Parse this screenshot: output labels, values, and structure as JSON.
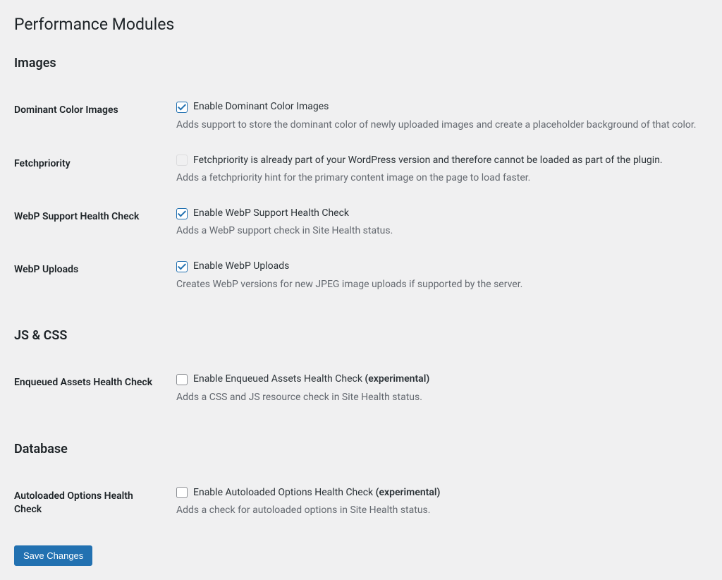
{
  "page_title": "Performance Modules",
  "sections": {
    "images": {
      "heading": "Images",
      "dominant_color": {
        "label": "Dominant Color Images",
        "checkbox_label": "Enable Dominant Color Images",
        "description": "Adds support to store the dominant color of newly uploaded images and create a placeholder background of that color.",
        "checked": true,
        "disabled": false
      },
      "fetchpriority": {
        "label": "Fetchpriority",
        "checkbox_label": "Fetchpriority is already part of your WordPress version and therefore cannot be loaded as part of the plugin.",
        "description": "Adds a fetchpriority hint for the primary content image on the page to load faster.",
        "checked": false,
        "disabled": true
      },
      "webp_health": {
        "label": "WebP Support Health Check",
        "checkbox_label": "Enable WebP Support Health Check",
        "description": "Adds a WebP support check in Site Health status.",
        "checked": true,
        "disabled": false
      },
      "webp_uploads": {
        "label": "WebP Uploads",
        "checkbox_label": "Enable WebP Uploads",
        "description": "Creates WebP versions for new JPEG image uploads if supported by the server.",
        "checked": true,
        "disabled": false
      }
    },
    "jscss": {
      "heading": "JS & CSS",
      "enqueued_assets": {
        "label": "Enqueued Assets Health Check",
        "checkbox_label_prefix": "Enable Enqueued Assets Health Check ",
        "checkbox_label_suffix": "(experimental)",
        "description": "Adds a CSS and JS resource check in Site Health status.",
        "checked": false,
        "disabled": false
      }
    },
    "database": {
      "heading": "Database",
      "autoloaded": {
        "label": "Autoloaded Options Health Check",
        "checkbox_label_prefix": "Enable Autoloaded Options Health Check ",
        "checkbox_label_suffix": "(experimental)",
        "description": "Adds a check for autoloaded options in Site Health status.",
        "checked": false,
        "disabled": false
      }
    }
  },
  "save_button": "Save Changes"
}
